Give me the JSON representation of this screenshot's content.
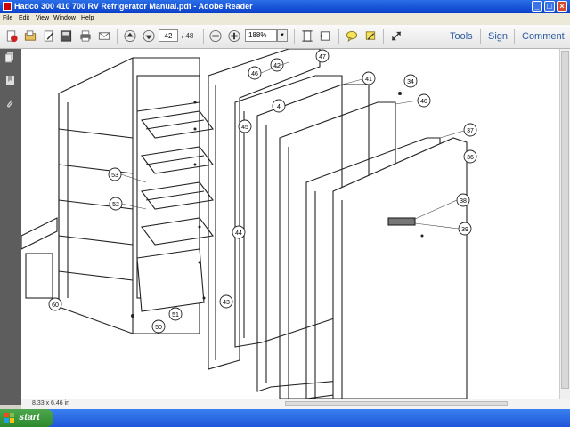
{
  "window": {
    "title": "Hadco 300 410 700 RV Refrigerator Manual.pdf - Adobe Reader"
  },
  "menu": [
    "File",
    "Edit",
    "View",
    "Window",
    "Help"
  ],
  "toolbar": {
    "page_current": "42",
    "page_total": "/ 48",
    "zoom": "188%",
    "tools_label": "Tools",
    "sign_label": "Sign",
    "comment_label": "Comment"
  },
  "document": {
    "callouts": [
      "46",
      "42",
      "47",
      "41",
      "34",
      "40",
      "45",
      "4",
      "37",
      "36",
      "53",
      "52",
      "38",
      "39",
      "44",
      "50",
      "51",
      "43",
      "60"
    ]
  },
  "status": {
    "page_size": "8.33 x 6.46 in"
  },
  "taskbar": {
    "start_label": "start"
  },
  "colors": {
    "titlebar": "#0a3fc8",
    "taskbar": "#2a63e0",
    "start": "#3a9a3a",
    "link": "#2a5aa0"
  }
}
